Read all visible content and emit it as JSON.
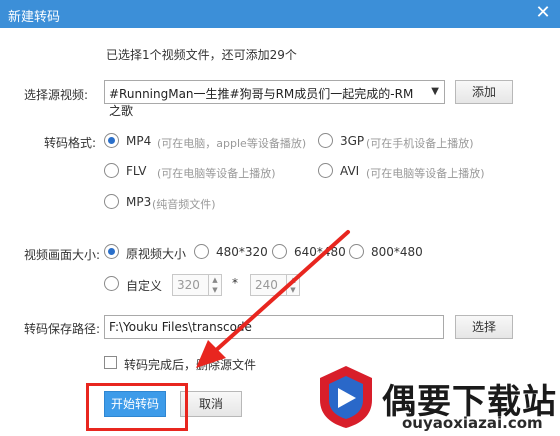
{
  "window": {
    "title": "新建转码",
    "close_glyph": "✕"
  },
  "info_text": "已选择1个视频文件，还可添加29个",
  "source": {
    "label": "选择源视频:",
    "selected": "#RunningMan一生推#狗哥与RM成员们一起完成的-RM之歌",
    "dropdown_glyph": "▼",
    "add_button": "添加"
  },
  "format": {
    "label": "转码格式:",
    "options": [
      {
        "name": "MP4",
        "hint": "(可在电脑，apple等设备播放)",
        "selected": true
      },
      {
        "name": "3GP",
        "hint": "(可在手机设备上播放)",
        "selected": false
      },
      {
        "name": "FLV",
        "hint": "(可在电脑等设备上播放)",
        "selected": false
      },
      {
        "name": "AVI",
        "hint": "(可在电脑等设备上播放)",
        "selected": false
      },
      {
        "name": "MP3",
        "hint": "(纯音频文件)",
        "selected": false
      }
    ]
  },
  "size": {
    "label": "视频画面大小:",
    "options": [
      {
        "name": "原视频大小",
        "selected": true
      },
      {
        "name": "480*320",
        "selected": false
      },
      {
        "name": "640*480",
        "selected": false
      },
      {
        "name": "800*480",
        "selected": false
      },
      {
        "name": "自定义",
        "selected": false
      }
    ],
    "custom_width": "320",
    "custom_height": "240",
    "separator": "*",
    "spin_up": "▲",
    "spin_down": "▼"
  },
  "output": {
    "label": "转码保存路径:",
    "path": "F:\\Youku Files\\transcode",
    "browse_button": "选择"
  },
  "delete_source": {
    "label": "转码完成后，删除源文件",
    "checked": false
  },
  "actions": {
    "start": "开始转码",
    "cancel": "取消"
  },
  "watermark": {
    "brand": "偶要下载站",
    "url": "ouyaoxiazai.com"
  },
  "colors": {
    "titlebar": "#3c8fd8",
    "primary_button": "#3d9be9",
    "highlight_box": "#e8261f",
    "arrow": "#e8261f"
  }
}
